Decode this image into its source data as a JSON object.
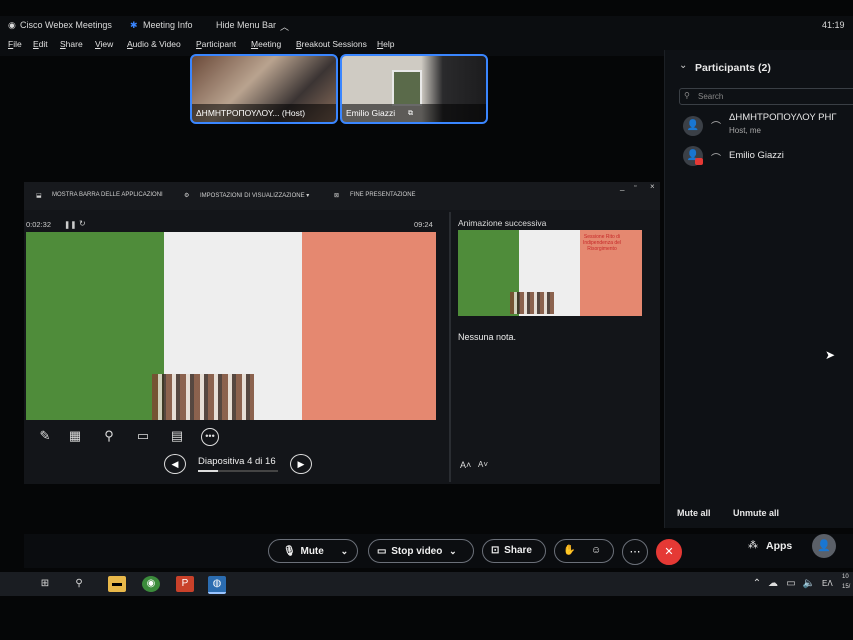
{
  "topbar": {
    "app_name": "Cisco Webex Meetings",
    "meeting_info": "Meeting Info",
    "hide_menu": "Hide Menu Bar",
    "clock": "41:19"
  },
  "menu": [
    "File",
    "Edit",
    "Share",
    "View",
    "Audio & Video",
    "Participant",
    "Meeting",
    "Breakout Sessions",
    "Help"
  ],
  "thumbnails": [
    {
      "label": "ΔΗΜΗΤΡΟΠΟΥΛΟΥ... (Host)"
    },
    {
      "label": "Emilio Giazzi"
    }
  ],
  "participants": {
    "title": "Participants (2)",
    "search_placeholder": "Search",
    "list": [
      {
        "name": "ΔΗΜΗΤΡΟΠΟΥΛΟΥ ΡΗΓ",
        "role": "Host, me"
      },
      {
        "name": "Emilio Giazzi",
        "role": ""
      }
    ],
    "mute_all": "Mute all",
    "unmute_all": "Unmute all"
  },
  "presenter": {
    "tool_taskbar": "MOSTRA BARRA DELLE APPLICAZIONI",
    "tool_settings": "IMPOSTAZIONI DI VISUALIZZAZIONE ▾",
    "tool_end": "FINE PRESENTAZIONE",
    "timer": "0:02:32",
    "clock": "09:24",
    "next_anim": "Animazione successiva",
    "next_slide_text": "Sessione Rito di Indipendenza del Risorgimento",
    "notes": "Nessuna nota.",
    "slide_counter": "Diapositiva 4 di 16"
  },
  "controls": {
    "mute": "Mute",
    "stop_video": "Stop video",
    "share": "Share",
    "apps": "Apps"
  },
  "tray": {
    "lang": "ΕΛ",
    "time": "10",
    "date": "15/"
  },
  "colors": {
    "accent_blue": "#3a86ff",
    "end_red": "#e53935",
    "flag_green": "#4f8c3a",
    "flag_white": "#eeeeee",
    "flag_red": "#e58870"
  }
}
